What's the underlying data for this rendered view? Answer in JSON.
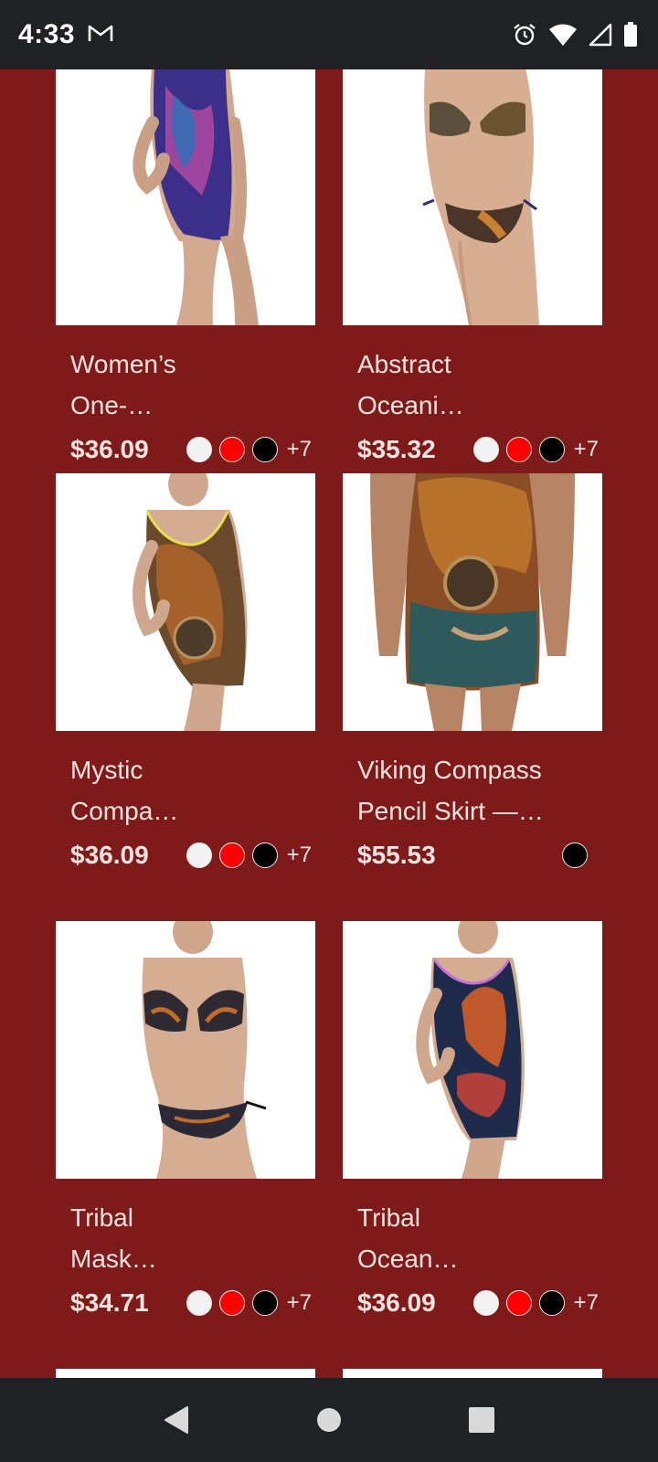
{
  "status_bar": {
    "time": "4:33",
    "notification_icon": "gmail-icon",
    "icons": [
      "alarm-icon",
      "wifi-icon",
      "cell-signal-icon",
      "battery-icon"
    ]
  },
  "colors": {
    "background": "#7f1a1b",
    "system_bar": "#202124",
    "swatch_white": "#f2f2f2",
    "swatch_red": "#ff0000",
    "swatch_black": "#000000"
  },
  "products": [
    {
      "title": "Women’s One-…",
      "title_line1": "Women’s",
      "title_line2": "One-…",
      "price": "$36.09",
      "more_colors": "+7",
      "image": "one-piece swimsuit"
    },
    {
      "title": "Abstract Oceani…",
      "title_line1": "Abstract",
      "title_line2": "Oceani…",
      "price": "$35.32",
      "more_colors": "+7",
      "image": "bikini"
    },
    {
      "title": "Mystic Compa…",
      "title_line1": "Mystic",
      "title_line2": "Compa…",
      "price": "$36.09",
      "more_colors": "+7",
      "image": "one-piece swimsuit"
    },
    {
      "title": "Viking Compass Pencil Skirt —…",
      "title_line1": "Viking Compass",
      "title_line2": "Pencil Skirt —…",
      "price": "$55.53",
      "more_colors": "",
      "image": "pencil skirt"
    },
    {
      "title": "Tribal Mask…",
      "title_line1": "Tribal",
      "title_line2": "Mask…",
      "price": "$34.71",
      "more_colors": "+7",
      "image": "bikini"
    },
    {
      "title": "Tribal Ocean…",
      "title_line1": "Tribal",
      "title_line2": "Ocean…",
      "price": "$36.09",
      "more_colors": "+7",
      "image": "one-piece swimsuit"
    }
  ],
  "nav_bar": {
    "buttons": [
      "back-icon",
      "home-icon",
      "recents-icon"
    ]
  }
}
